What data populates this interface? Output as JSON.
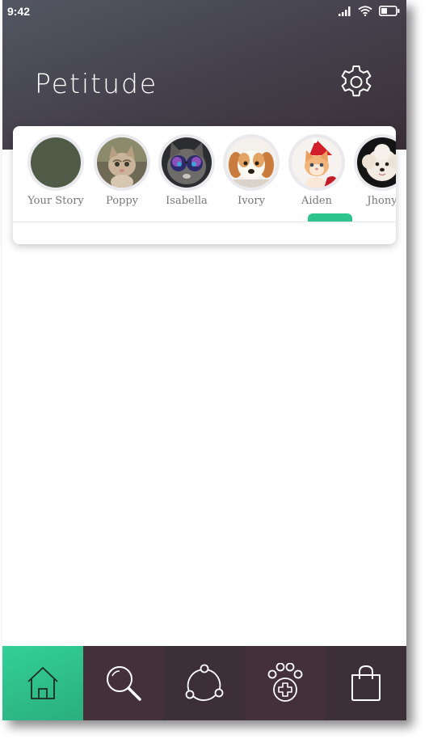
{
  "status_bar": {
    "time": "9:42"
  },
  "header": {
    "title": "Petitude"
  },
  "stories": [
    {
      "name": "Your Story"
    },
    {
      "name": "Poppy"
    },
    {
      "name": "Isabella"
    },
    {
      "name": "Ivory"
    },
    {
      "name": "Aiden",
      "active": true
    },
    {
      "name": "Jhony"
    }
  ],
  "colors": {
    "accent": "#2ec48e",
    "header_dark": "#3a2f36",
    "nav_dark": "#443039"
  },
  "bottom_nav": [
    {
      "icon": "home-icon",
      "active": true
    },
    {
      "icon": "search-icon"
    },
    {
      "icon": "share-icon"
    },
    {
      "icon": "paw-plus-icon"
    },
    {
      "icon": "shopping-bag-icon"
    }
  ]
}
